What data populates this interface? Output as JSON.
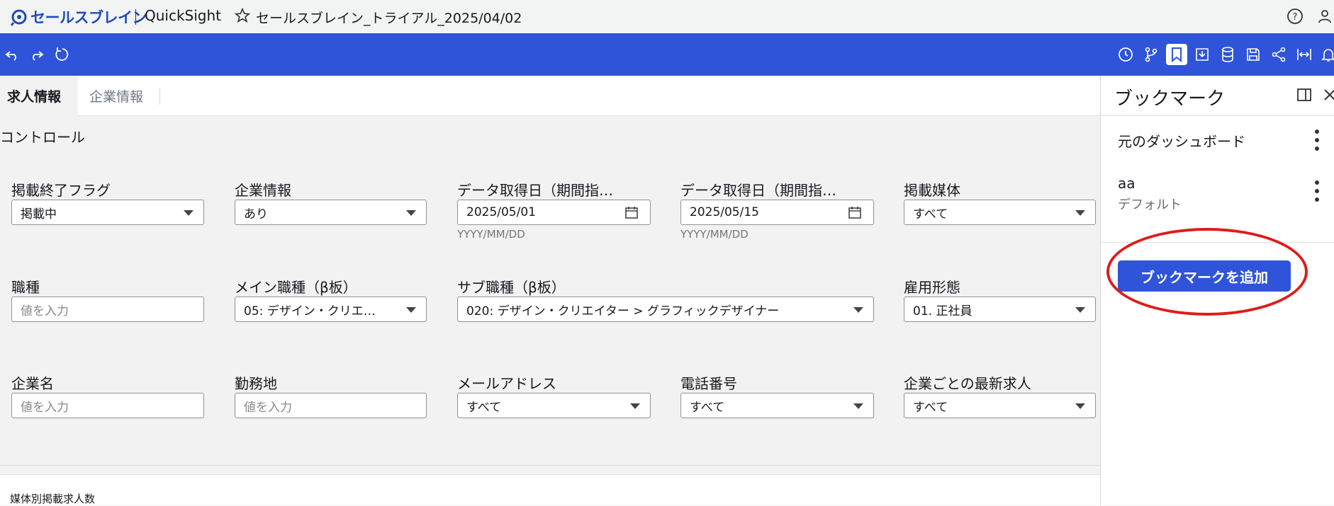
{
  "header": {
    "brand": "セールスブレイン",
    "product": "QuickSight",
    "doc_title": "セールスブレイン_トライアル_2025/04/02"
  },
  "toolbar": {
    "left_icons": [
      "undo-icon",
      "redo-icon",
      "reset-icon"
    ],
    "right_icons": [
      "history-icon",
      "branch-icon",
      "bookmark-icon",
      "download-icon",
      "dataset-icon",
      "save-icon",
      "share-icon",
      "fit-width-icon",
      "bell-icon"
    ]
  },
  "tabs": [
    {
      "label": "求人情報",
      "active": true
    },
    {
      "label": "企業情報",
      "active": false
    }
  ],
  "controls": {
    "title": "コントロール",
    "row1": [
      {
        "label": "掲載終了フラグ",
        "value": "掲載中",
        "type": "dropdown"
      },
      {
        "label": "企業情報",
        "value": "あり",
        "type": "dropdown"
      },
      {
        "label": "データ取得日（期間指…",
        "value": "2025/05/01",
        "type": "date",
        "hint": "YYYY/MM/DD"
      },
      {
        "label": "データ取得日（期間指…",
        "value": "2025/05/15",
        "type": "date",
        "hint": "YYYY/MM/DD"
      },
      {
        "label": "掲載媒体",
        "value": "すべて",
        "type": "dropdown"
      }
    ],
    "row2": [
      {
        "label": "職種",
        "placeholder": "値を入力",
        "type": "text"
      },
      {
        "label": "メイン職種（β板）",
        "value": "05: デザイン・クリエ…",
        "type": "dropdown"
      },
      {
        "label": "サブ職種（β板）",
        "value": "020: デザイン・クリエイター > グラフィックデザイナー",
        "type": "dropdown"
      },
      {
        "label": "雇用形態",
        "value": "01. 正社員",
        "type": "dropdown"
      }
    ],
    "row3": [
      {
        "label": "企業名",
        "placeholder": "値を入力",
        "type": "text"
      },
      {
        "label": "勤務地",
        "placeholder": "値を入力",
        "type": "text"
      },
      {
        "label": "メールアドレス",
        "value": "すべて",
        "type": "dropdown"
      },
      {
        "label": "電話番号",
        "value": "すべて",
        "type": "dropdown"
      },
      {
        "label": "企業ごとの最新求人",
        "value": "すべて",
        "type": "dropdown"
      }
    ]
  },
  "visual": {
    "title": "媒体別掲載求人数"
  },
  "bookmarks": {
    "title": "ブックマーク",
    "items": [
      {
        "name": "元のダッシュボード"
      },
      {
        "name": "aa",
        "subtitle": "デフォルト"
      }
    ],
    "add_button": "ブックマークを追加",
    "highlight_color": "#e01b1b",
    "accent_color": "#2f54d9"
  }
}
